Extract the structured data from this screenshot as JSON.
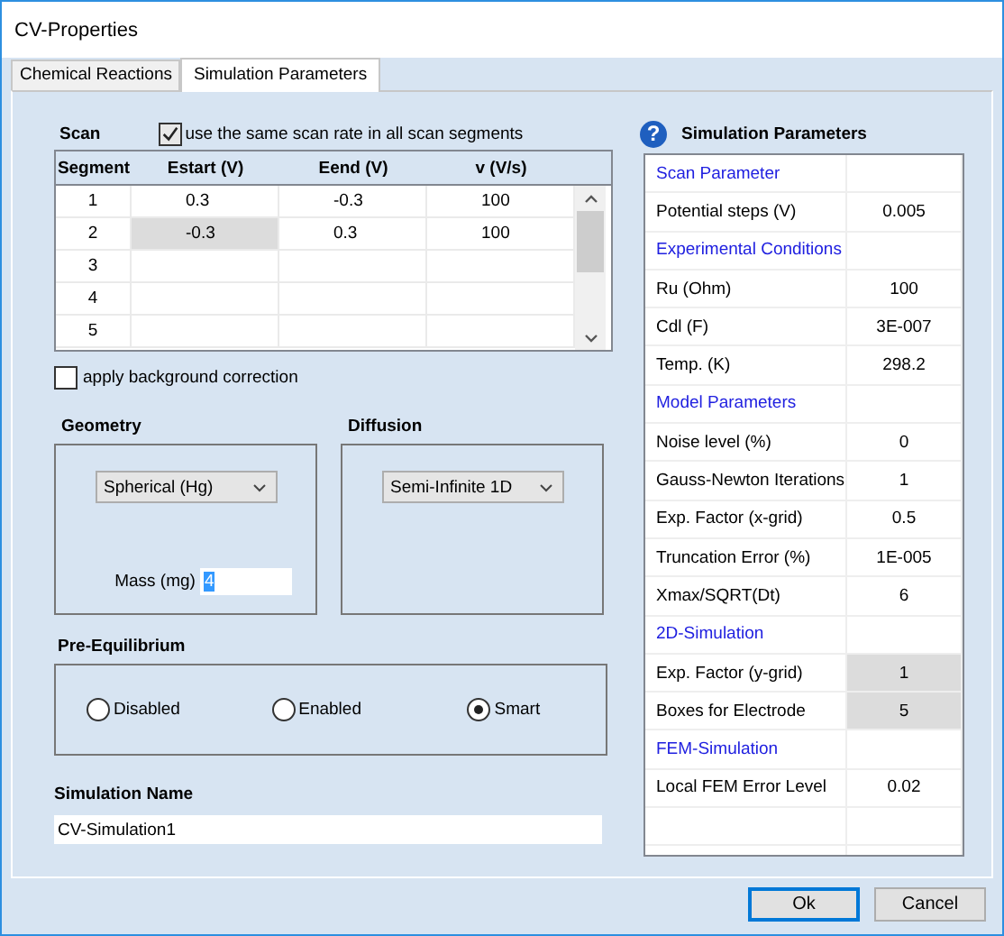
{
  "window": {
    "title": "CV-Properties"
  },
  "tabs": [
    {
      "label": "Chemical Reactions",
      "selected": false
    },
    {
      "label": "Simulation Parameters",
      "selected": true
    }
  ],
  "scan": {
    "label": "Scan",
    "same_rate": {
      "label": "use the same scan rate in all scan segments",
      "checked": true
    },
    "columns": [
      "Segment",
      "Estart (V)",
      "Eend (V)",
      "v (V/s)"
    ],
    "rows": [
      {
        "segment": "1",
        "cells": [
          {
            "text": "0.3",
            "selected": false
          },
          {
            "text": "-0.3",
            "selected": false
          },
          {
            "text": "100",
            "selected": false
          }
        ]
      },
      {
        "segment": "2",
        "cells": [
          {
            "text": "-0.3",
            "selected": true
          },
          {
            "text": "0.3",
            "selected": false
          },
          {
            "text": "100",
            "selected": false
          }
        ]
      },
      {
        "segment": "3"
      },
      {
        "segment": "4"
      },
      {
        "segment": "5"
      }
    ]
  },
  "background_correction": {
    "label": "apply background correction",
    "checked": false
  },
  "geometry": {
    "label": "Geometry",
    "value": "Spherical (Hg)",
    "mass_label": "Mass (mg)",
    "mass": "4",
    "mass_text_selected": true
  },
  "diffusion": {
    "label": "Diffusion",
    "value": "Semi-Infinite 1D"
  },
  "pre_equilibrium": {
    "label": "Pre-Equilibrium",
    "options": [
      {
        "label": "Disabled",
        "selected": false
      },
      {
        "label": "Enabled",
        "selected": false
      },
      {
        "label": "Smart",
        "selected": true
      }
    ]
  },
  "simulation_name": {
    "label": "Simulation Name",
    "value": "CV-Simulation1"
  },
  "parameters": {
    "help": "?",
    "title": "Simulation Parameters",
    "rows": [
      {
        "kind": "heading",
        "label": "Scan Parameter"
      },
      {
        "kind": "param",
        "label": "Potential steps (V)",
        "value": "0.005",
        "disabled": false
      },
      {
        "kind": "heading",
        "label": "Experimental Conditions"
      },
      {
        "kind": "param",
        "label": "Ru (Ohm)",
        "value": "100",
        "disabled": false
      },
      {
        "kind": "param",
        "label": "Cdl (F)",
        "value": "3E-007",
        "disabled": false
      },
      {
        "kind": "param",
        "label": "Temp. (K)",
        "value": "298.2",
        "disabled": false
      },
      {
        "kind": "heading",
        "label": "Model Parameters"
      },
      {
        "kind": "param",
        "label": "Noise level (%)",
        "value": "0",
        "disabled": false
      },
      {
        "kind": "param",
        "label": "Gauss-Newton Iterations",
        "value": "1",
        "disabled": false
      },
      {
        "kind": "param",
        "label": "Exp. Factor (x-grid)",
        "value": "0.5",
        "disabled": false
      },
      {
        "kind": "param",
        "label": "Truncation Error (%)",
        "value": "1E-005",
        "disabled": false
      },
      {
        "kind": "param",
        "label": "Xmax/SQRT(Dt)",
        "value": "6",
        "disabled": false
      },
      {
        "kind": "heading",
        "label": "2D-Simulation"
      },
      {
        "kind": "param",
        "label": "Exp. Factor (y-grid)",
        "value": "1",
        "disabled": true
      },
      {
        "kind": "param",
        "label": "Boxes for Electrode",
        "value": "5",
        "disabled": true
      },
      {
        "kind": "heading",
        "label": "FEM-Simulation"
      },
      {
        "kind": "param",
        "label": "Local FEM Error Level",
        "value": "0.02",
        "disabled": false
      }
    ]
  },
  "buttons": [
    {
      "label": "Ok",
      "default": true
    },
    {
      "label": "Cancel",
      "default": false
    }
  ]
}
